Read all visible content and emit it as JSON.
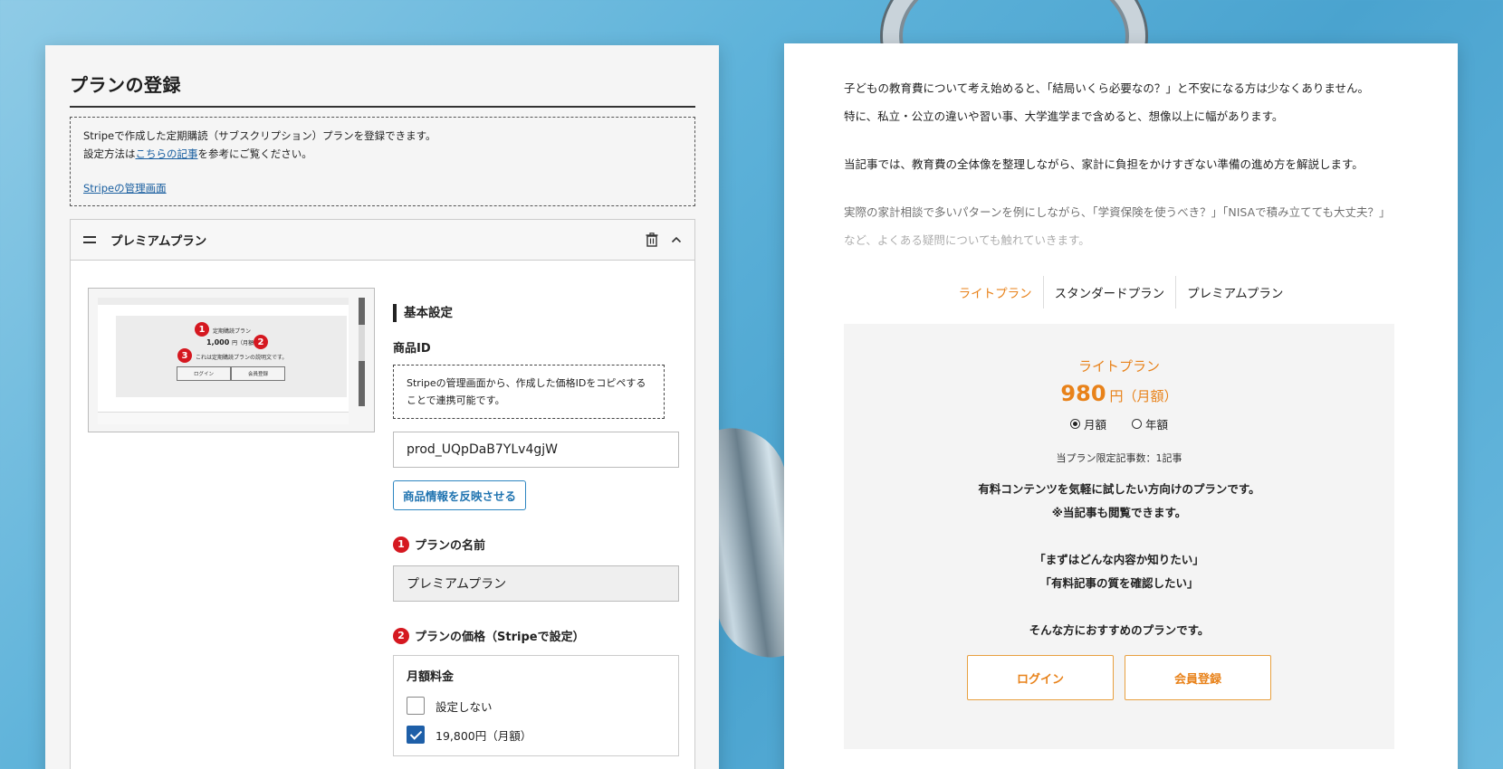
{
  "admin": {
    "title": "プランの登録",
    "notice": {
      "line1": "Stripeで作成した定期購読（サブスクリプション）プランを登録できます。",
      "line2_prefix": "設定方法は",
      "line2_link": "こちらの記事",
      "line2_suffix": "を参考にご覧ください。",
      "stripe_link": "Stripeの管理画面"
    },
    "plan_panel": {
      "title": "プレミアムプラン",
      "preview": {
        "plan_label": "定期購読プラン",
        "price": "1,000",
        "price_suffix": "円（月額）",
        "description": "これは定期購読プランの説明文です。",
        "login": "ログイン",
        "register": "会員登録",
        "badges": [
          "1",
          "2",
          "3"
        ]
      },
      "basic_settings": "基本設定",
      "product_id_label": "商品ID",
      "product_id_help": "Stripeの管理画面から、作成した価格IDをコピペすることで連携可能です。",
      "product_id_value": "prod_UQpDaB7YLv4gjW",
      "reflect_button": "商品情報を反映させる",
      "name_label": "プランの名前",
      "name_value": "プレミアムプラン",
      "price_label": "プランの価格（Stripeで設定）",
      "monthly_title": "月額料金",
      "options": [
        {
          "label": "設定しない",
          "checked": false
        },
        {
          "label": "19,800円（月額）",
          "checked": true
        }
      ]
    }
  },
  "article": {
    "para1": "子どもの教育費について考え始めると、「結局いくら必要なの？」と不安になる方は少なくありません。",
    "para1b": "特に、私立・公立の違いや習い事、大学進学まで含めると、想像以上に幅があります。",
    "para2": "当記事では、教育費の全体像を整理しながら、家計に負担をかけすぎない準備の進め方を解説します。",
    "para3": "実際の家計相談で多いパターンを例にしながら、「学資保険を使うべき？」「NISAで積み立てても大丈夫？」など、よくある疑問についても触れていきます。",
    "tabs": [
      "ライトプラン",
      "スタンダードプラン",
      "プレミアムプラン"
    ],
    "plan": {
      "name": "ライトプラン",
      "amount": "980",
      "unit": "円",
      "period": "（月額）",
      "monthly": "月額",
      "yearly": "年額",
      "limit": "当プラン限定記事数：1記事",
      "desc1": "有料コンテンツを気軽に試したい方向けのプランです。",
      "desc2": "※当記事も閲覧できます。",
      "quote1": "「まずはどんな内容か知りたい」",
      "quote2": "「有料記事の質を確認したい」",
      "desc3": "そんな方におすすめのプランです。",
      "login": "ログイン",
      "register": "会員登録"
    }
  },
  "colors": {
    "accent_orange": "#e8821a",
    "link_blue": "#1a5fa0",
    "badge_red": "#d51820",
    "check_blue": "#1e5fa8"
  }
}
